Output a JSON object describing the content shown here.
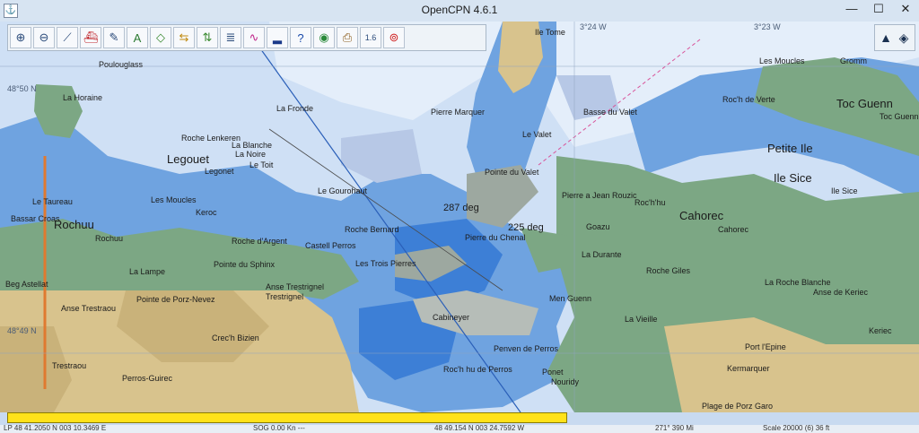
{
  "window": {
    "title": "OpenCPN 4.6.1",
    "minimize": "—",
    "maximize": "☐",
    "close": "✕"
  },
  "toolbar": {
    "buttons": [
      {
        "name": "zoom-in-button",
        "icon": "zoom-in-icon",
        "glyph": "⊕"
      },
      {
        "name": "zoom-out-button",
        "icon": "zoom-out-icon",
        "glyph": "⊖"
      },
      {
        "name": "route-button",
        "icon": "route-icon",
        "glyph": "⟋"
      },
      {
        "name": "ship-button",
        "icon": "ship-icon",
        "glyph": "⛴"
      },
      {
        "name": "settings-button",
        "icon": "wrench-icon",
        "glyph": "✎"
      },
      {
        "name": "text-button",
        "icon": "text-icon",
        "glyph": "A"
      },
      {
        "name": "measure-button",
        "icon": "measure-icon",
        "glyph": "◇"
      },
      {
        "name": "arrows-h-button",
        "icon": "arrows-h-icon",
        "glyph": "⇆"
      },
      {
        "name": "arrows-v-button",
        "icon": "arrows-v-icon",
        "glyph": "⇅"
      },
      {
        "name": "route-manager-button",
        "icon": "route-manager-icon",
        "glyph": "≣"
      },
      {
        "name": "track-button",
        "icon": "track-icon",
        "glyph": "∿"
      },
      {
        "name": "tide-button",
        "icon": "tide-icon",
        "glyph": "▂"
      },
      {
        "name": "help-button",
        "icon": "help-icon",
        "glyph": "?"
      },
      {
        "name": "layers-button",
        "icon": "layers-icon",
        "glyph": "◉"
      },
      {
        "name": "print-button",
        "icon": "print-icon",
        "glyph": "⎙"
      },
      {
        "name": "scale-button",
        "icon": "scale-icon",
        "glyph": "1.6"
      },
      {
        "name": "mob-button",
        "icon": "lifebuoy-icon",
        "glyph": "⊚"
      }
    ],
    "compass_glyph": "▲",
    "gps_glyph": "◈"
  },
  "map": {
    "place_labels_big": [
      {
        "text": "Legouet"
      },
      {
        "text": "Rochuu"
      },
      {
        "text": "Petite Ile"
      },
      {
        "text": "Ile Sice"
      },
      {
        "text": "Toc Guenn"
      },
      {
        "text": "Cahorec"
      }
    ],
    "place_labels": [
      "Poulouglass",
      "La Horaine",
      "La Fronde",
      "Pierre Marquer",
      "Basse du Valet",
      "Les Moucles",
      "Gromm",
      "Roc'h de Verte",
      "Roche Lenkeren",
      "La Blanche",
      "La Noire",
      "Le Toit",
      "Legonet",
      "Le Valet",
      "Le Gourohaut",
      "Pointe du Valet",
      "Pierre a Jean Rouzic",
      "Roc'h'hu",
      "Le Taureau",
      "Les Moucles",
      "Keroc",
      "Bassar Croas",
      "Rochuu",
      "Roche d'Argent",
      "Castell Perros",
      "Roche Bernard",
      "Pierre du Chenal",
      "Goazu",
      "La Durante",
      "Cahorec",
      "Pointe du Sphinx",
      "La Lampe",
      "Les Trois Pierres",
      "Roche Giles",
      "Beg Astellat",
      "Anse Trestrignel",
      "Trestrignel",
      "Pointe de Porz-Nevez",
      "Men Guenn",
      "Anse Trestraou",
      "Cabineyer",
      "La Vieille",
      "La Roche Blanche",
      "Anse de Keriec",
      "Crec'h Bizien",
      "Penven de Perros",
      "Port l'Epine",
      "Keriec",
      "Trestraou",
      "Perros-Guirec",
      "Roc'h hu de Perros",
      "Ponet",
      "Kermarquer",
      "Nouridy",
      "Plage de Porz Garo",
      "Ile Tome",
      "Ile Sice",
      "Toc Guenn"
    ],
    "bearings": [
      "287 deg",
      "225 deg"
    ],
    "lat_label": "48°50 N",
    "lon_label": "3°24 W",
    "lon_label2": "3°23 W",
    "lat_label2": "48°49 N"
  },
  "status": {
    "position": "LP 48 41.2050 N  003 10.3469 E",
    "sog": "SOG 0.00 Kn  ---",
    "cursor": "48 49.154 N  003 24.7592 W",
    "range": "271°  390 Mi",
    "scale": "Scale 20000 (6)  36 ft"
  },
  "progress": {
    "value": 0.61
  },
  "colors": {
    "deep_water": "#cfe0f5",
    "shallow_water": "#6fa3e0",
    "very_shallow": "#3d7fd6",
    "land_green": "#7ca784",
    "land_tan": "#d8c38d",
    "town": "#b5a88a",
    "progress_yellow": "#ffe21a"
  }
}
